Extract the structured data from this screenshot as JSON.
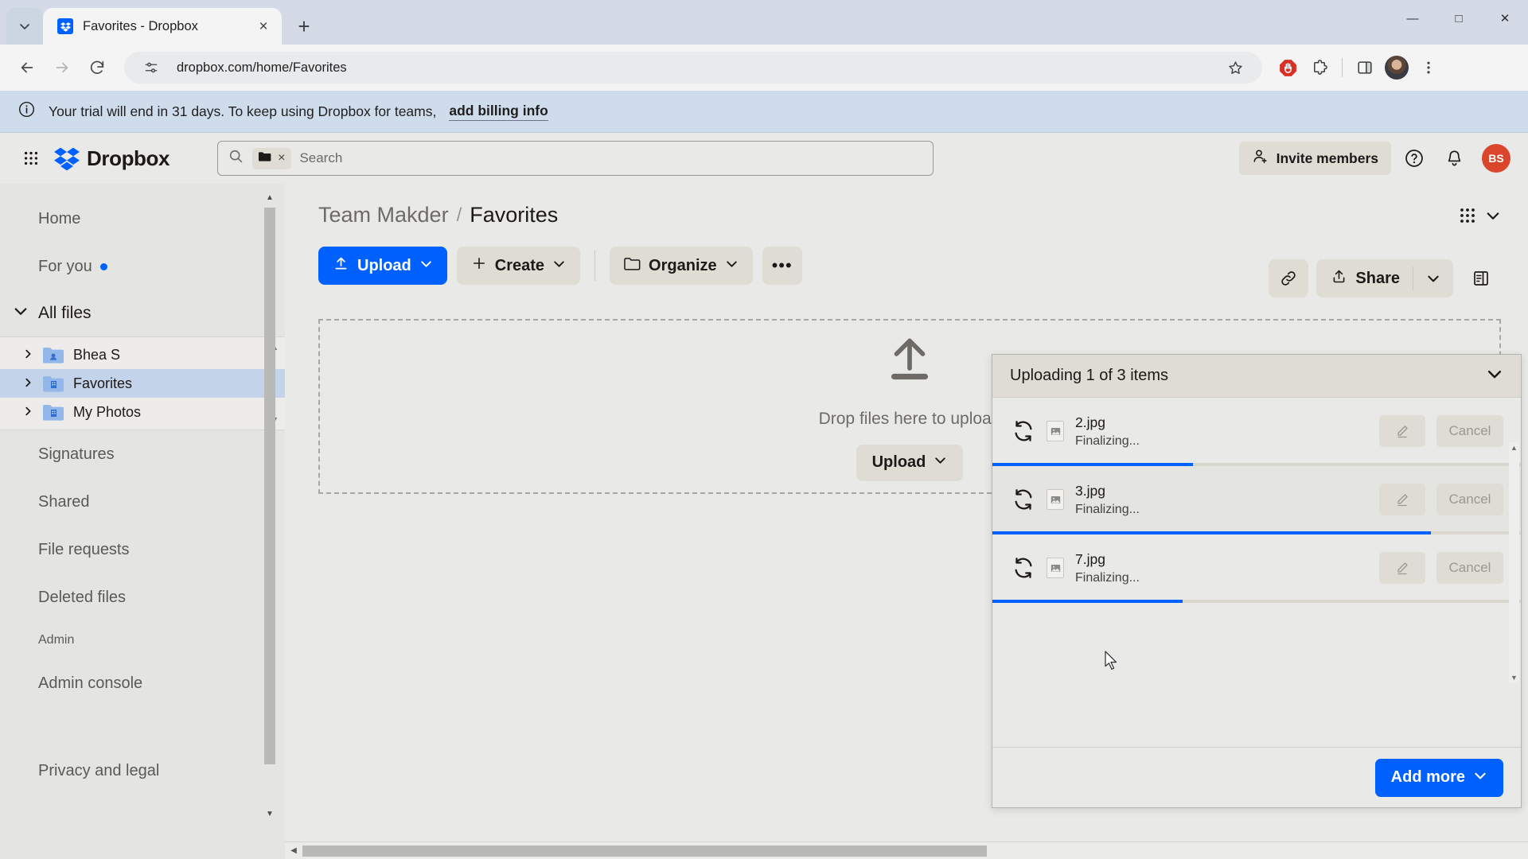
{
  "browser": {
    "tab": {
      "title": "Favorites - Dropbox",
      "favicon": "dropbox-icon",
      "close": "×"
    },
    "tabstrip_chevron": "chevron-down-icon",
    "new_tab": "+",
    "window_controls": {
      "minimize": "—",
      "maximize": "□",
      "close": "✕"
    },
    "nav": {
      "back": "←",
      "forward": "→",
      "reload": "↻"
    },
    "url": "dropbox.com/home/Favorites",
    "site_info_icon": "page-settings-icon",
    "actions": [
      "bookmark-star-icon",
      "adblock-icon",
      "extensions-icon",
      "split-view-icon",
      "profile-avatar",
      "chrome-menu-icon"
    ]
  },
  "trial_banner": {
    "icon": "info-icon",
    "text": "Your trial will end in 31 days. To keep using Dropbox for teams,",
    "link": "add billing info"
  },
  "header": {
    "apps_grid": "apps-grid-icon",
    "brand": "Dropbox",
    "search": {
      "icon": "search-icon",
      "chip_icon": "folder-icon",
      "chip_clear": "×",
      "placeholder": "Search",
      "value": ""
    },
    "invite_label": "Invite members",
    "help": "help-icon",
    "notifications": "bell-icon",
    "avatar_initials": "BS",
    "avatar_color": "#d9462b"
  },
  "sidebar": {
    "top_items": [
      {
        "label": "Home",
        "badge": false
      },
      {
        "label": "For you",
        "badge": true
      }
    ],
    "all_files_label": "All files",
    "folders": [
      {
        "label": "Bhea S",
        "active": false
      },
      {
        "label": "Favorites",
        "active": true
      },
      {
        "label": "My Photos",
        "active": false
      }
    ],
    "bottom_items": [
      {
        "label": "Signatures",
        "small": false
      },
      {
        "label": "Shared",
        "small": false
      },
      {
        "label": "File requests",
        "small": false
      },
      {
        "label": "Deleted files",
        "small": false
      },
      {
        "label": "Admin",
        "small": true
      },
      {
        "label": "Admin console",
        "small": false
      },
      {
        "label": "Privacy and legal",
        "small": false
      }
    ]
  },
  "main": {
    "breadcrumb": {
      "parent": "Team Makder",
      "separator": "/",
      "current": "Favorites"
    },
    "view_mode_icon": "grid-view-icon",
    "toolbar": {
      "upload": "Upload",
      "create": "Create",
      "organize": "Organize",
      "more": "•••"
    },
    "toolbar_right": {
      "copy_link": "link-icon",
      "share": "Share",
      "details_panel": "details-panel-icon"
    },
    "dropzone": {
      "icon": "upload-arrow-icon",
      "text": "Drop files here to upload",
      "button": "Upload"
    }
  },
  "upload_panel": {
    "title": "Uploading 1 of 3 items",
    "collapse_icon": "chevron-down-icon",
    "items": [
      {
        "name": "2.jpg",
        "status": "Finalizing...",
        "progress": 38,
        "edit": "pencil-icon",
        "cancel": "Cancel",
        "thumb": "image-file-icon"
      },
      {
        "name": "3.jpg",
        "status": "Finalizing...",
        "progress": 83,
        "edit": "pencil-icon",
        "cancel": "Cancel",
        "thumb": "image-file-icon"
      },
      {
        "name": "7.jpg",
        "status": "Finalizing...",
        "progress": 36,
        "edit": "pencil-icon",
        "cancel": "Cancel",
        "thumb": "image-file-icon"
      }
    ],
    "add_more": "Add more"
  },
  "colors": {
    "brand_blue": "#0061fe",
    "banner_blue": "#cfdcec",
    "app_bg": "#e9e9e7",
    "sidebar_bg": "#e4e4e1",
    "active_row": "#c3d3ea",
    "button_grey": "#dedcd3"
  }
}
